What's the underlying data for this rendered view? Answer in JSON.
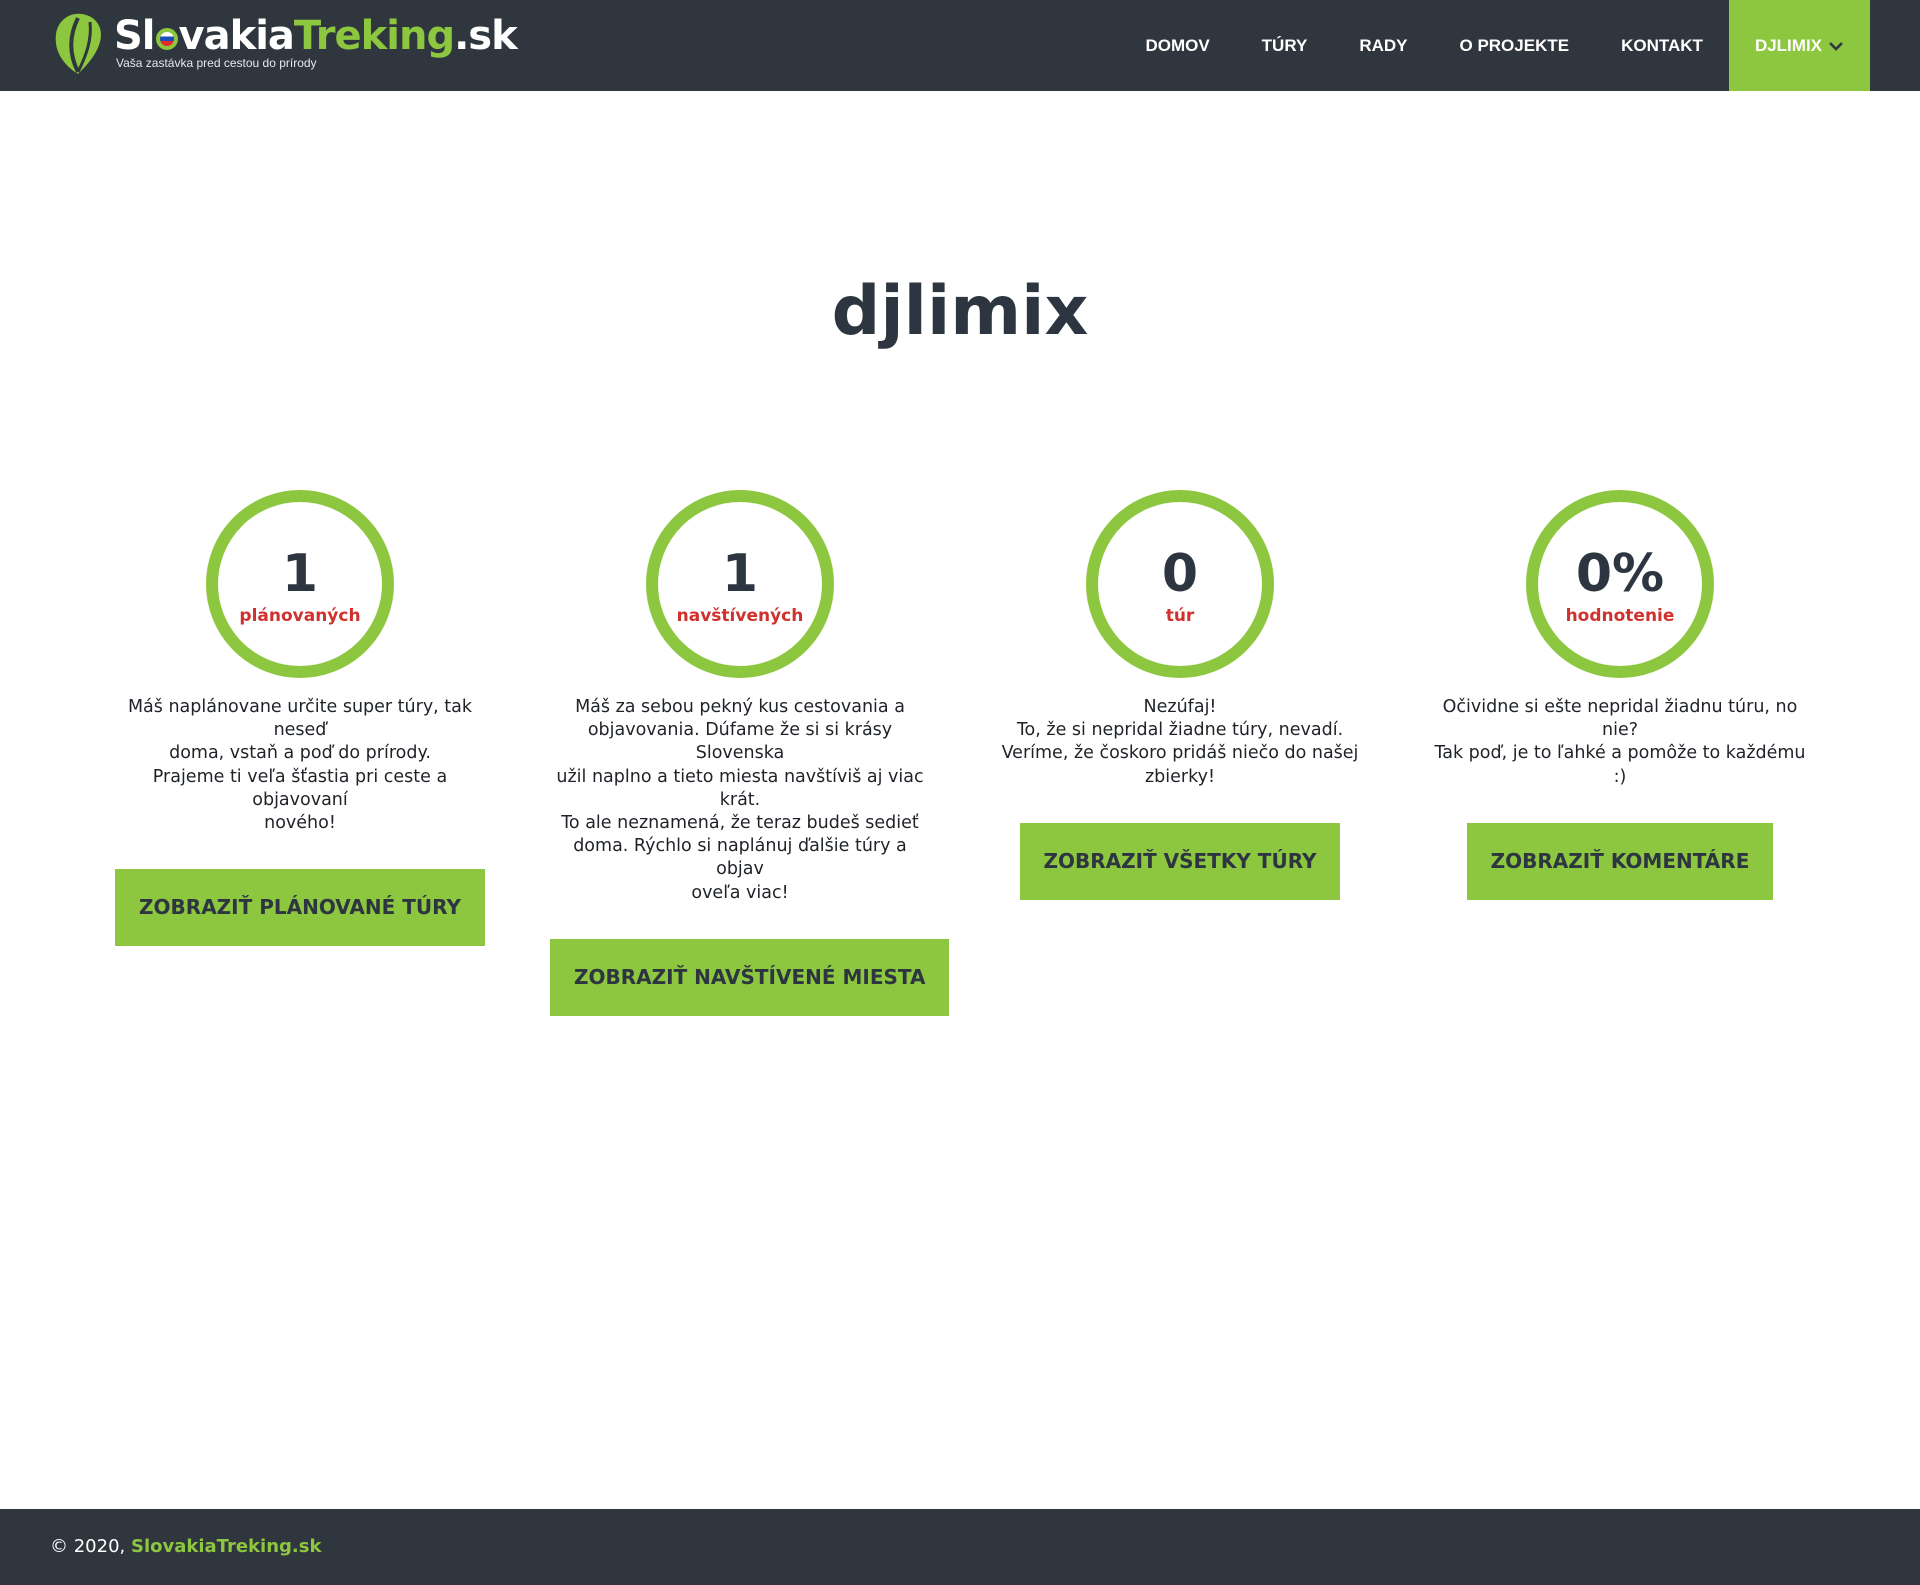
{
  "brand": {
    "name_part1": "Sl",
    "name_part2": "vakia",
    "name_part3": "Treking",
    "name_part4": ".sk",
    "tagline": "Vaša zastávka pred cestou do prírody",
    "primary_color": "#8dc63f",
    "dark_color": "#2f363e",
    "accent_red": "#d0312d"
  },
  "nav": {
    "items": [
      {
        "label": "DOMOV"
      },
      {
        "label": "TÚRY"
      },
      {
        "label": "RADY"
      },
      {
        "label": "O PROJEKTE"
      },
      {
        "label": "KONTAKT"
      }
    ],
    "user_label": "DJLIMIX",
    "user_icon": "chevron-down-icon"
  },
  "page": {
    "title": "djlimix"
  },
  "stats": [
    {
      "value": "1",
      "label": "plánovaných",
      "desc": [
        "Máš naplánovane určite super túry, tak neseď",
        "doma, vstaň a poď do prírody.",
        "Prajeme ti veľa šťastia pri ceste a objavovaní",
        "nového!"
      ],
      "button": "ZOBRAZIŤ PLÁNOVANÉ TÚRY"
    },
    {
      "value": "1",
      "label": "navštívených",
      "desc": [
        "Máš za sebou pekný kus cestovania a",
        "objavovania. Dúfame že si si krásy Slovenska",
        "užil naplno a tieto miesta navštíviš aj viac krát.",
        "To ale neznamená, že teraz budeš sedieť",
        "doma. Rýchlo si naplánuj ďalšie túry a objav",
        "oveľa viac!"
      ],
      "button": "ZOBRAZIŤ NAVŠTÍVENÉ MIESTA"
    },
    {
      "value": "0",
      "label": "túr",
      "desc": [
        "Nezúfaj!",
        "To, že si nepridal žiadne túry, nevadí.",
        "Veríme, že čoskoro pridáš niečo do našej",
        "zbierky!"
      ],
      "button": "ZOBRAZIŤ VŠETKY TÚRY"
    },
    {
      "value": "0%",
      "label": "hodnotenie",
      "desc": [
        "Očividne si ešte nepridal žiadnu túru, no nie?",
        "Tak poď, je to ľahké a pomôže to každému :)"
      ],
      "button": "ZOBRAZIŤ KOMENTÁRE"
    }
  ],
  "footer": {
    "prefix": "© 2020,",
    "brand": "SlovakiaTreking.sk"
  }
}
